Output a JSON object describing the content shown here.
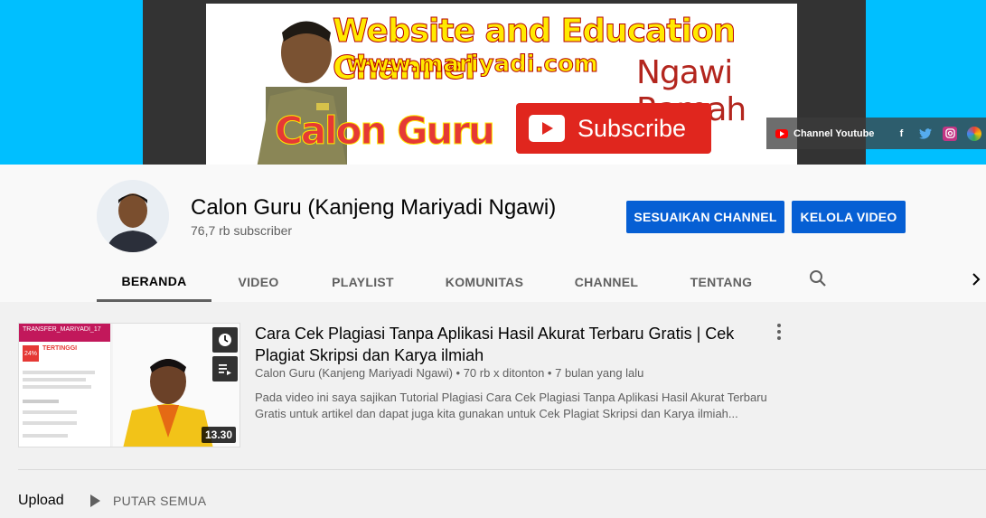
{
  "banner": {
    "title": "Website and Education Channel",
    "url": "www.mariyadi.com",
    "tagline": "Ngawi Ramah",
    "calon_guru": "Calon Guru",
    "subscribe": "Subscribe",
    "links_label": "Channel Youtube",
    "socials": [
      "facebook-icon",
      "twitter-icon",
      "instagram-icon",
      "pinwheel-icon"
    ]
  },
  "channel": {
    "name": "Calon Guru (Kanjeng Mariyadi Ngawi)",
    "subscribers": "76,7 rb subscriber",
    "customize_label": "SESUAIKAN CHANNEL",
    "manage_label": "KELOLA VIDEO"
  },
  "tabs": [
    {
      "label": "BERANDA",
      "active": true
    },
    {
      "label": "VIDEO"
    },
    {
      "label": "PLAYLIST"
    },
    {
      "label": "KOMUNITAS"
    },
    {
      "label": "CHANNEL"
    },
    {
      "label": "TENTANG"
    }
  ],
  "featured": {
    "title": "Cara Cek Plagiasi Tanpa Aplikasi Hasil Akurat Terbaru Gratis | Cek Plagiat Skripsi dan Karya ilmiah",
    "meta": "Calon Guru (Kanjeng Mariyadi Ngawi) • 70 rb x ditonton • 7 bulan yang lalu",
    "description": "Pada video ini saya sajikan Tutorial Plagiasi Cara Cek Plagiasi Tanpa Aplikasi Hasil Akurat Terbaru Gratis untuk artikel dan dapat juga kita gunakan untuk Cek Plagiat Skripsi dan Karya ilmiah...",
    "duration": "13.30",
    "thumb": {
      "header": "TRANSFER_MARIYADI_17",
      "percent": "24%",
      "risk_label": "TERTINGGI"
    }
  },
  "section": {
    "title": "Upload",
    "play_all": "PUTAR SEMUA"
  },
  "colors": {
    "banner_bg": "#00bfff",
    "primary_button": "#065fd4",
    "subscribe_red": "#e0261e"
  }
}
